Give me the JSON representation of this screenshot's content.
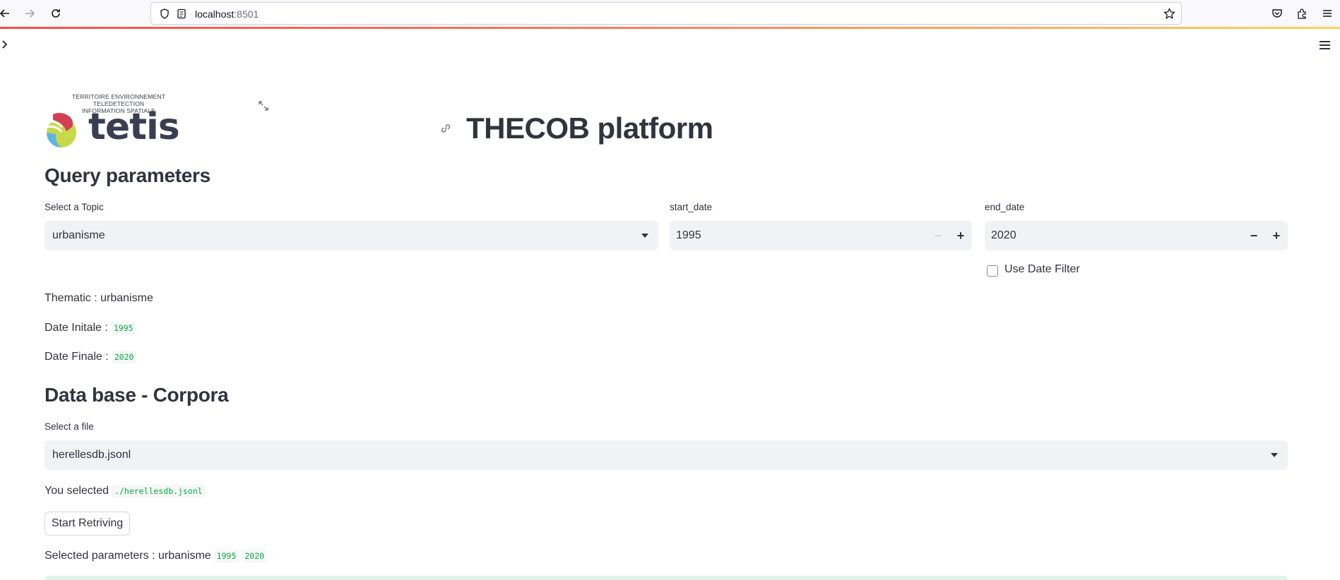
{
  "browser": {
    "url_host": "localhost",
    "url_port": ":8501"
  },
  "logo": {
    "top_line1": "TERRITOIRE ENVIRONNEMENT TELEDETECTION",
    "top_line2": "INFORMATION SPATIALE",
    "word": "tetis"
  },
  "page": {
    "title": "THECOB platform"
  },
  "query": {
    "heading": "Query parameters",
    "topic_label": "Select a Topic",
    "topic_value": "urbanisme",
    "start_label": "start_date",
    "start_value": "1995",
    "end_label": "end_date",
    "end_value": "2020",
    "date_filter_label": "Use Date Filter",
    "date_filter_checked": false
  },
  "summary": {
    "thematic_label": "Thematic : urbanisme",
    "date_initial_label": "Date Initale :",
    "date_initial_value": "1995",
    "date_final_label": "Date Finale :",
    "date_final_value": "2020"
  },
  "database": {
    "heading": "Data base - Corpora",
    "file_label": "Select a file",
    "file_value": "herellesdb.jsonl",
    "selected_prefix": "You selected",
    "selected_path": "./herellesdb.jsonl",
    "start_button": "Start Retriving",
    "params_prefix": "Selected parameters : urbanisme",
    "params_start": "1995",
    "params_end": "2020"
  },
  "colors": {
    "accent": "#ff4b4b",
    "code_green": "#09ab3b",
    "widget_bg": "#f0f2f6",
    "text": "#31333f"
  }
}
